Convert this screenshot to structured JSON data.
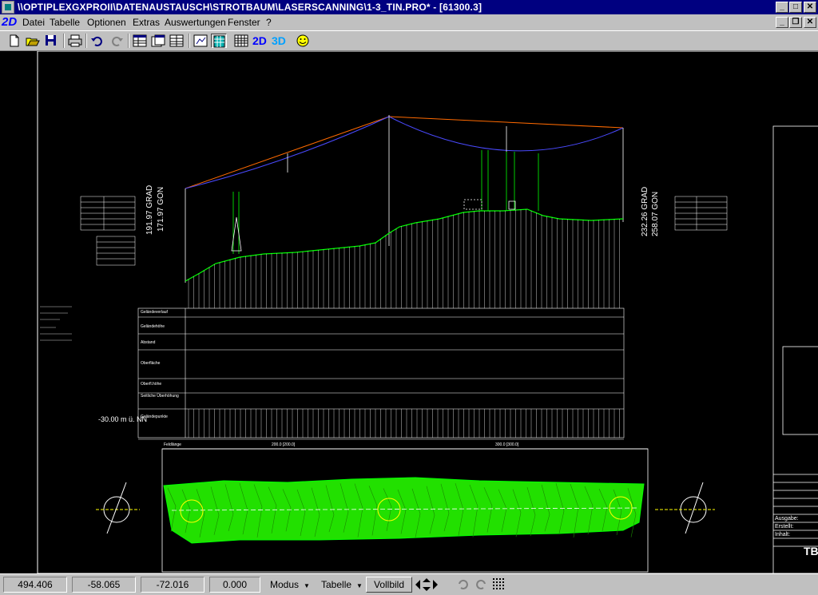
{
  "window": {
    "title": "\\\\OPTIPLEXGXPROII\\DATENAUSTAUSCH\\STROTBAUM\\LASERSCANNING\\1-3_TIN.PRO* - [61300.3]",
    "controls": {
      "minimize": "_",
      "maximize": "□",
      "close": "✕",
      "restore": "❐"
    }
  },
  "menu": {
    "mode_label": "2D",
    "items": [
      "Datei",
      "Tabelle",
      "Optionen",
      "Extras",
      "Auswertungen",
      "Fenster",
      "?"
    ]
  },
  "toolbar": {
    "buttons": [
      "new-document",
      "open-folder",
      "save-disk",
      "print",
      "undo",
      "redo",
      "table-view-1",
      "table-view-2",
      "table-view-3",
      "tin-view",
      "grid-view",
      "2D",
      "3D",
      "smiley"
    ],
    "label_2d": "2D",
    "label_3d": "3D"
  },
  "drawing": {
    "left_axis_label": "-30.00 m ü. NN",
    "left_angles": [
      "191.97 GRAD",
      "171.97 GON"
    ],
    "right_angles": [
      "232.26 GRAD",
      "258.07 GON"
    ],
    "row_labels": [
      "Geländeverlauf",
      "Geländehöhe",
      "Abstand",
      "Oberfläche",
      "Oberfl.höhe",
      "Seitliche Überhöhung",
      "Geländepunkte"
    ],
    "plan_labels": {
      "left": "Feldlänge",
      "mid1": "200.0 [200.0]",
      "mid2": "300.0 [300.0]"
    },
    "title_block": {
      "ausgabe": "Ausgabe:",
      "erstellt": "Erstellt:",
      "inhalt": "Inhalt:",
      "logo": "TB"
    },
    "colors": {
      "conductor": "#ff6a00",
      "sag": "#4040ff",
      "terrain": "#00ff00",
      "grid": "#ffffff",
      "background": "#000000"
    }
  },
  "status": {
    "x": "494.406",
    "y": "-58.065",
    "z": "-72.016",
    "angle": "0.000",
    "modus": "Modus",
    "tabelle": "Tabelle",
    "vollbild": "Vollbild"
  }
}
